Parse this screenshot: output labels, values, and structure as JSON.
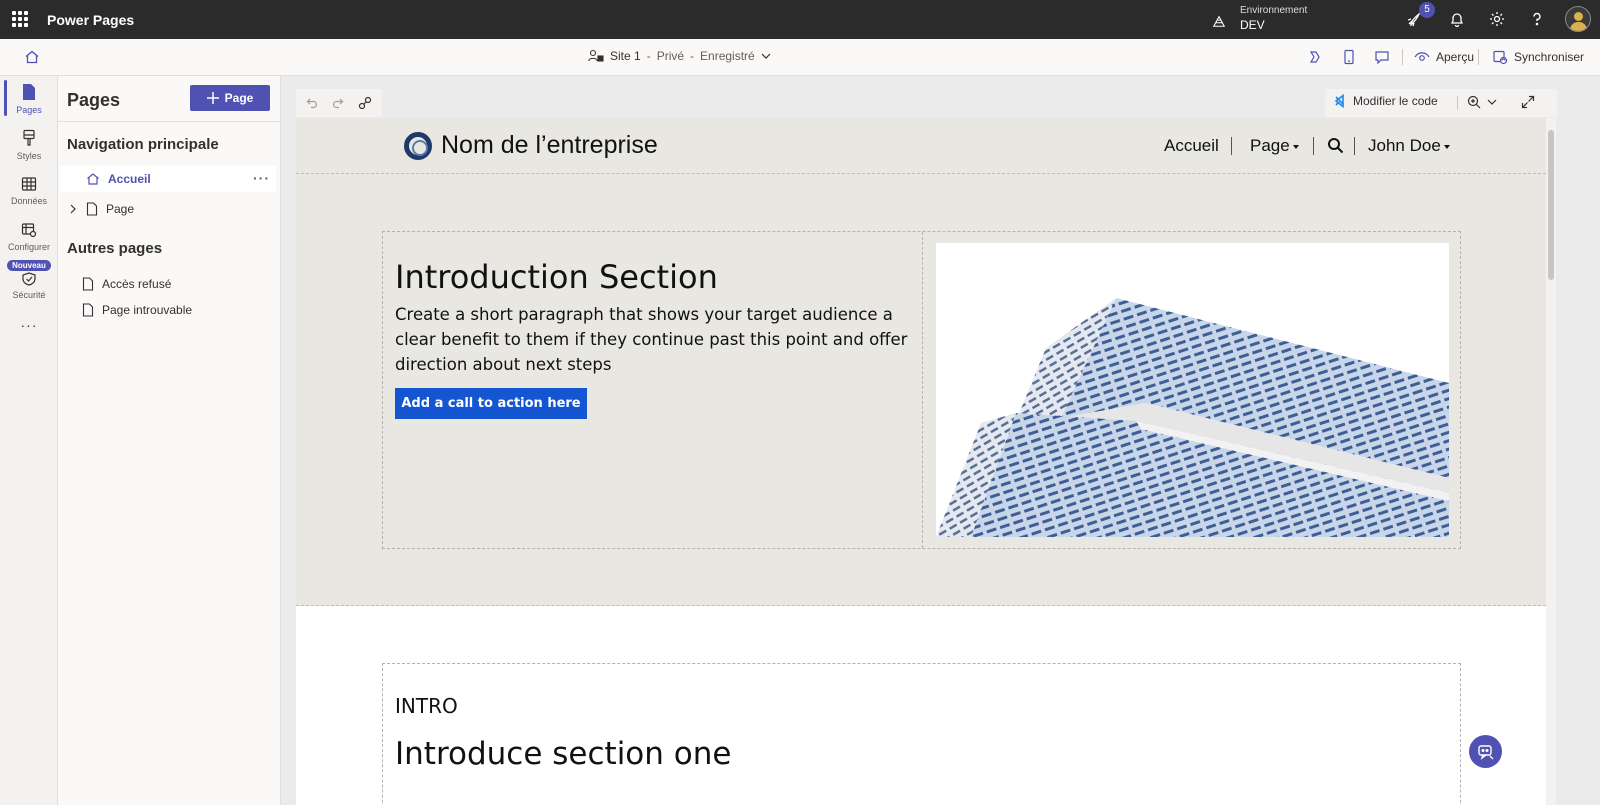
{
  "topbar": {
    "app_name": "Power Pages",
    "environment_label": "Environnement",
    "environment_name": "DEV",
    "notification_count": "5"
  },
  "subbar": {
    "site_name": "Site 1",
    "site_separator": "-",
    "site_visibility": "Privé",
    "site_save_state": "Enregistré",
    "preview_label": "Aperçu",
    "sync_label": "Synchroniser"
  },
  "rail": {
    "items": [
      {
        "label": "Pages",
        "icon": "page-icon",
        "active": true
      },
      {
        "label": "Styles",
        "icon": "paintbrush-icon"
      },
      {
        "label": "Données",
        "icon": "table-icon"
      },
      {
        "label": "Configurer",
        "icon": "settings-table-icon"
      },
      {
        "label": "Sécurité",
        "icon": "shield-icon",
        "badge": "Nouveau"
      }
    ],
    "more": "···"
  },
  "panel": {
    "title": "Pages",
    "add_button_label": "Page",
    "main_nav_heading": "Navigation principale",
    "main_nav": [
      {
        "label": "Accueil",
        "icon": "home-icon",
        "selected": true,
        "more": "···"
      },
      {
        "label": "Page",
        "icon": "page-icon",
        "expandable": true
      }
    ],
    "other_heading": "Autres pages",
    "other_pages": [
      {
        "label": "Accès refusé",
        "icon": "page-icon"
      },
      {
        "label": "Page introuvable",
        "icon": "page-icon"
      }
    ]
  },
  "canvas_toolbar": {
    "edit_code_label": "Modifier le code"
  },
  "site": {
    "company_name": "Nom de l’entreprise",
    "nav": {
      "home": "Accueil",
      "page": "Page",
      "user": "John Doe"
    },
    "hero": {
      "title": "Introduction Section",
      "paragraph": "Create a short paragraph that shows your target audience a clear benefit to them if they continue past this point and offer direction about next steps",
      "cta_label": "Add a call to action here"
    },
    "section2": {
      "eyebrow": "INTRO",
      "title": "Introduce section one"
    }
  },
  "colors": {
    "accent": "#4f52b2",
    "topbar": "#2b2b2b",
    "site_background": "#e8e7e2",
    "cta": "#1456d2"
  }
}
